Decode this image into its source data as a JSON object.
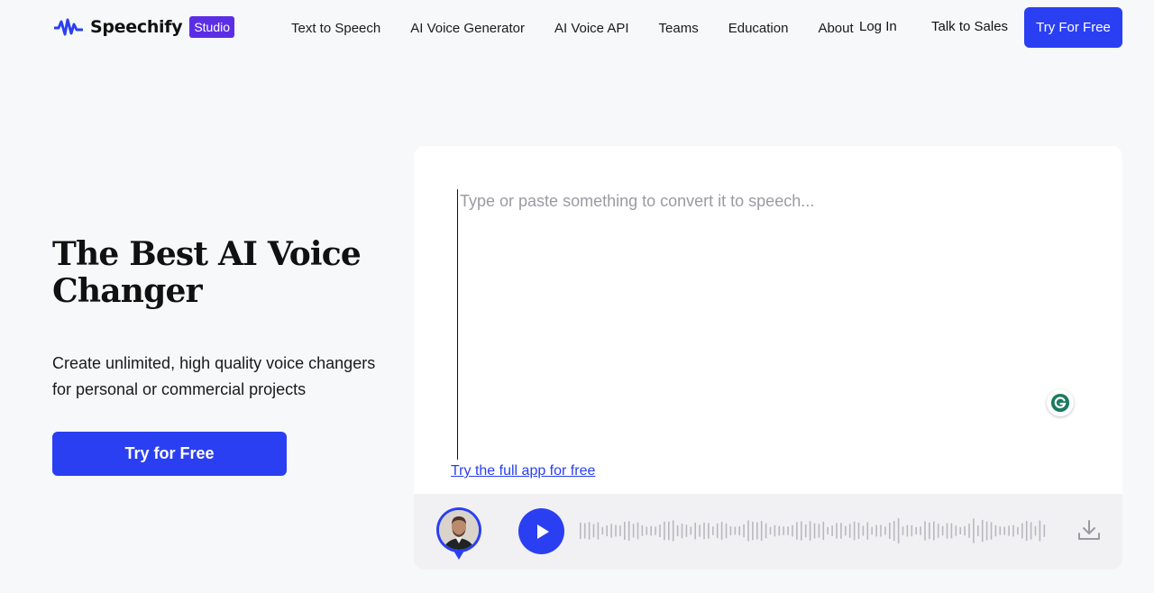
{
  "header": {
    "logo_text": "Speechify",
    "logo_badge": "Studio",
    "nav": [
      "Text to Speech",
      "AI Voice Generator",
      "AI Voice API",
      "Teams",
      "Education",
      "About"
    ],
    "login": "Log In",
    "sales": "Talk to Sales",
    "cta": "Try For Free"
  },
  "hero": {
    "title": "The Best AI Voice Changer",
    "subtitle": "Create unlimited, high quality voice changers for personal or commercial projects",
    "cta": "Try for Free"
  },
  "editor": {
    "placeholder": "Type or paste something to convert it to speech...",
    "full_app_link": "Try the full app for free"
  },
  "player": {
    "play_icon": "play-icon",
    "download_icon": "download-icon"
  },
  "colors": {
    "accent": "#2b3ff2",
    "badge": "#5b2ee6",
    "background": "#f7f8fa"
  }
}
